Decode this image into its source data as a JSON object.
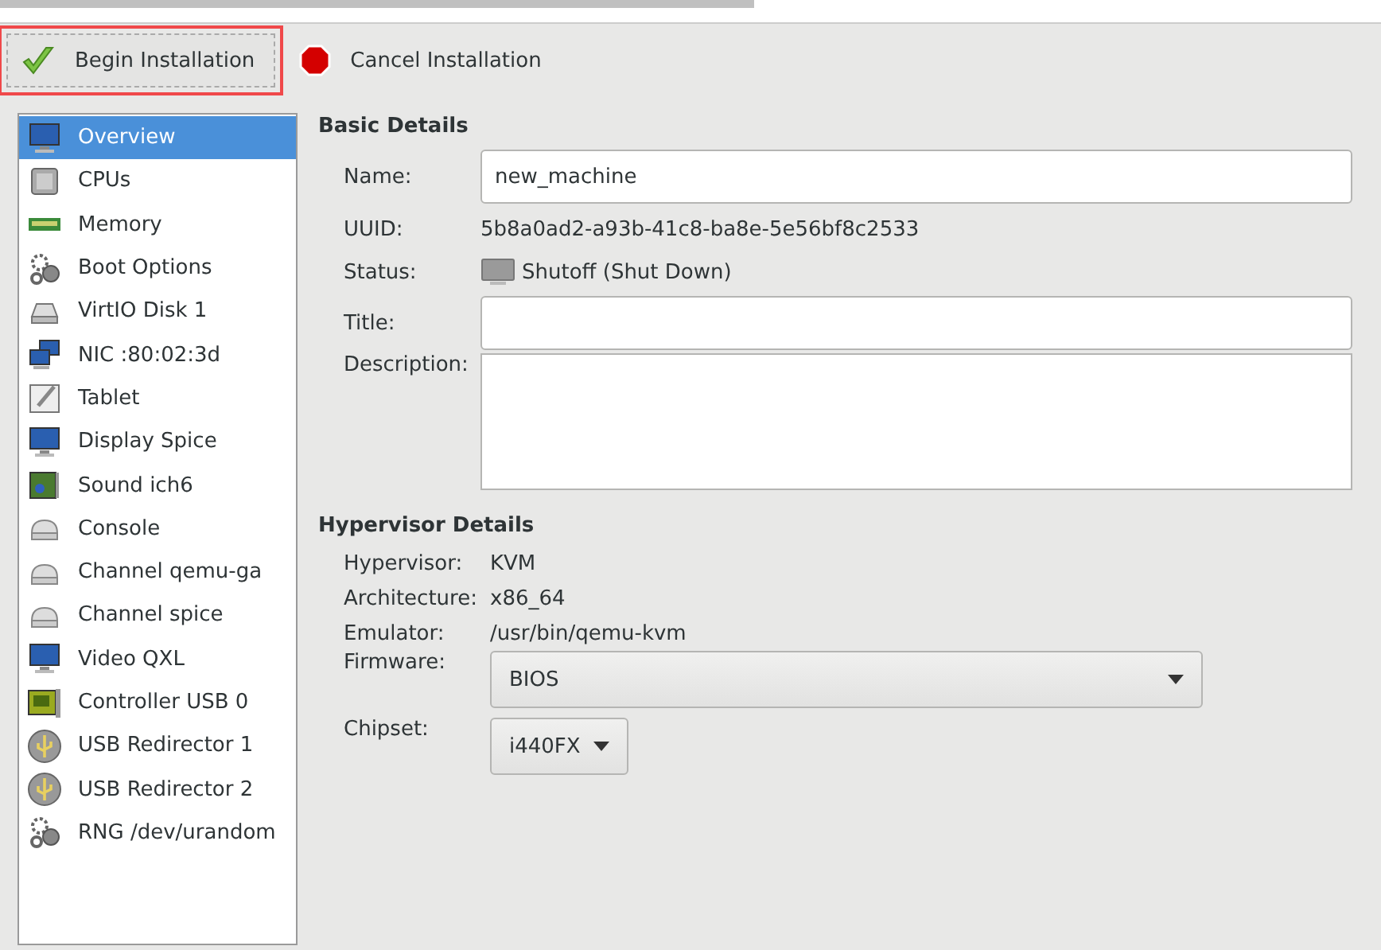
{
  "toolbar": [
    {
      "label": "Begin Installation",
      "kind": "check",
      "highlighted": true
    },
    {
      "label": "Cancel Installation",
      "kind": "stop",
      "highlighted": false
    }
  ],
  "sidebar": {
    "items": [
      {
        "label": "Overview",
        "kind": "monitor",
        "selected": true
      },
      {
        "label": "CPUs",
        "kind": "chip",
        "selected": false
      },
      {
        "label": "Memory",
        "kind": "memory",
        "selected": false
      },
      {
        "label": "Boot Options",
        "kind": "gears",
        "selected": false
      },
      {
        "label": "VirtIO Disk 1",
        "kind": "disk",
        "selected": false
      },
      {
        "label": "NIC :80:02:3d",
        "kind": "network",
        "selected": false
      },
      {
        "label": "Tablet",
        "kind": "tablet",
        "selected": false
      },
      {
        "label": "Display Spice",
        "kind": "monitor",
        "selected": false
      },
      {
        "label": "Sound ich6",
        "kind": "sound",
        "selected": false
      },
      {
        "label": "Console",
        "kind": "serial",
        "selected": false
      },
      {
        "label": "Channel qemu-ga",
        "kind": "serial",
        "selected": false
      },
      {
        "label": "Channel spice",
        "kind": "serial",
        "selected": false
      },
      {
        "label": "Video QXL",
        "kind": "monitor",
        "selected": false
      },
      {
        "label": "Controller USB 0",
        "kind": "card",
        "selected": false
      },
      {
        "label": "USB Redirector 1",
        "kind": "usb",
        "selected": false
      },
      {
        "label": "USB Redirector 2",
        "kind": "usb",
        "selected": false
      },
      {
        "label": "RNG /dev/urandom",
        "kind": "gears",
        "selected": false
      }
    ]
  },
  "basic_details": {
    "title": "Basic Details",
    "fields": [
      {
        "label": "Name:",
        "kind": "input",
        "value": "new_machine"
      },
      {
        "label": "UUID:",
        "kind": "text",
        "value": "5b8a0ad2-a93b-41c8-ba8e-5e56bf8c2533"
      },
      {
        "label": "Status:",
        "kind": "status",
        "value": "Shutoff (Shut Down)"
      },
      {
        "label": "Title:",
        "kind": "input"
      },
      {
        "label": "Description:",
        "kind": "textarea"
      }
    ]
  },
  "hypervisor_details": {
    "title": "Hypervisor Details",
    "fields": [
      {
        "label": "Hypervisor:",
        "kind": "text",
        "value": "KVM"
      },
      {
        "label": "Architecture:",
        "kind": "text",
        "value": "x86_64"
      },
      {
        "label": "Emulator:",
        "kind": "text",
        "value": "/usr/bin/qemu-kvm"
      },
      {
        "label": "Firmware:",
        "kind": "wide_select",
        "value": "BIOS"
      },
      {
        "label": "Chipset:",
        "kind": "select",
        "value": "i440FX"
      }
    ]
  }
}
